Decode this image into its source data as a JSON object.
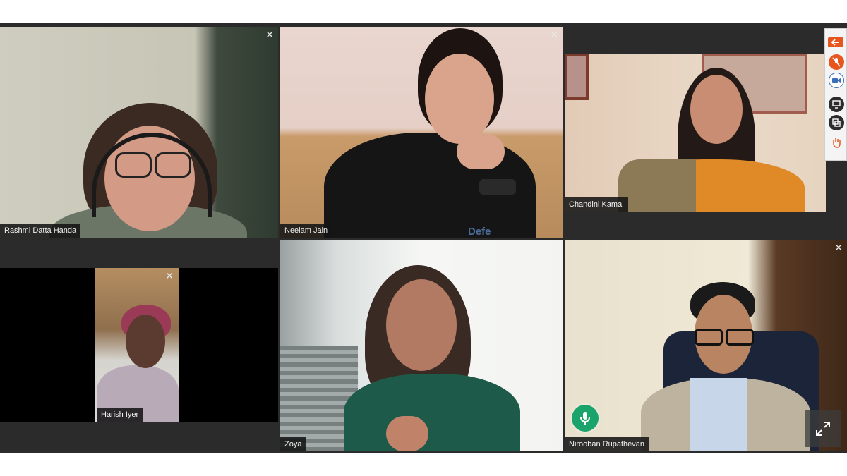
{
  "participants": [
    {
      "id": "rashmi",
      "name": "Rashmi Datta Handa",
      "close": "✕"
    },
    {
      "id": "neelam",
      "name": "Neelam Jain",
      "close": "✕"
    },
    {
      "id": "chandini",
      "name": "Chandini Kamal"
    },
    {
      "id": "harish",
      "name": "Harish Iyer",
      "close": "✕"
    },
    {
      "id": "zoya",
      "name": "Zoya"
    },
    {
      "id": "nirooban",
      "name": "Nirooban Rupathevan",
      "close": "✕"
    }
  ],
  "shirt_text": "Defe",
  "toolbar": {
    "icons": [
      "back-arrow-icon",
      "mic-muted-icon",
      "camera-icon",
      "screen-share-icon",
      "gallery-view-icon",
      "raise-hand-icon"
    ]
  },
  "colors": {
    "active_speaker": "#1aa36b",
    "toolbar_accent": "#e8561f"
  }
}
